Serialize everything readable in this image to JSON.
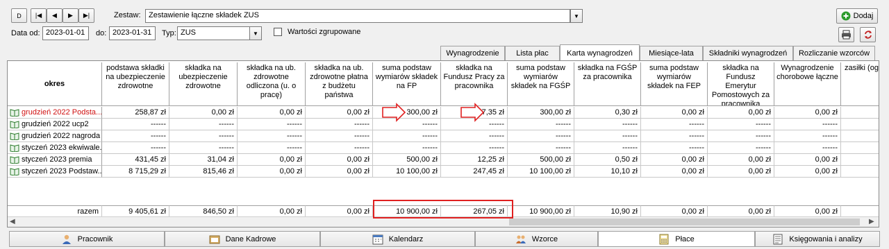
{
  "nav": {
    "first": "D",
    "prev_block": "|◀",
    "prev": "◀",
    "next": "▶",
    "last": "▶|"
  },
  "zestaw": {
    "label": "Zestaw:",
    "value": "Zestawienie łączne składek ZUS"
  },
  "filters": {
    "data_od_label": "Data od:",
    "data_od": "2023-01-01",
    "do_label": "do:",
    "do": "2023-01-31",
    "typ_label": "Typ:",
    "typ": "ZUS",
    "grouped_label": "Wartości zgrupowane"
  },
  "toolbar": {
    "dodaj": "Dodaj"
  },
  "tabs": [
    {
      "label": "Wynagrodzenie"
    },
    {
      "label": "Lista płac"
    },
    {
      "label": "Karta wynagrodzeń"
    },
    {
      "label": "Miesiące-lata"
    },
    {
      "label": "Składniki wynagrodzeń"
    },
    {
      "label": "Rozliczanie wzorców"
    }
  ],
  "table": {
    "row_header": "okres",
    "columns": [
      "podstawa składki na ubezpieczenie zdrowotne",
      "składka na ubezpieczenie zdrowotne",
      "składka na ub. zdrowotne odliczona (u. o pracę)",
      "składka na ub. zdrowotne płatna z budżetu państwa",
      "suma podstaw wymiarów składek na FP",
      "składka na Fundusz Pracy za pracownika",
      "suma podstaw wymiarów składek na FGŚP",
      "składka na FGŚP za pracownika",
      "suma podstaw wymiarów składek na FEP",
      "składka na Fundusz Emerytur Pomostowych za pracownika",
      "Wynagrodzenie chorobowe łączne",
      "zasiłki (og"
    ],
    "rows": [
      {
        "label": "grudzień 2022 Podsta...",
        "highlight": true,
        "values": [
          "258,87 zł",
          "0,00 zł",
          "0,00 zł",
          "0,00 zł",
          "300,00 zł",
          "7,35 zł",
          "300,00 zł",
          "0,30 zł",
          "0,00 zł",
          "0,00 zł",
          "0,00 zł",
          ""
        ]
      },
      {
        "label": "grudzień 2022 ucp2",
        "highlight": false,
        "values": [
          "------",
          "------",
          "------",
          "------",
          "------",
          "------",
          "------",
          "------",
          "------",
          "------",
          "------",
          ""
        ]
      },
      {
        "label": "grudzień 2022 nagroda",
        "highlight": false,
        "values": [
          "------",
          "------",
          "------",
          "------",
          "------",
          "------",
          "------",
          "------",
          "------",
          "------",
          "------",
          ""
        ]
      },
      {
        "label": "styczeń 2023 ekwiwale...",
        "highlight": false,
        "values": [
          "------",
          "------",
          "------",
          "------",
          "------",
          "------",
          "------",
          "------",
          "------",
          "------",
          "------",
          ""
        ]
      },
      {
        "label": "styczeń 2023 premia",
        "highlight": false,
        "values": [
          "431,45 zł",
          "31,04 zł",
          "0,00 zł",
          "0,00 zł",
          "500,00 zł",
          "12,25 zł",
          "500,00 zł",
          "0,50 zł",
          "0,00 zł",
          "0,00 zł",
          "0,00 zł",
          ""
        ]
      },
      {
        "label": "styczeń 2023 Podstaw...",
        "highlight": false,
        "values": [
          "8 715,29 zł",
          "815,46 zł",
          "0,00 zł",
          "0,00 zł",
          "10 100,00 zł",
          "247,45 zł",
          "10 100,00 zł",
          "10,10 zł",
          "0,00 zł",
          "0,00 zł",
          "0,00 zł",
          ""
        ]
      }
    ],
    "total_label": "razem",
    "totals": [
      "9 405,61 zł",
      "846,50 zł",
      "0,00 zł",
      "0,00 zł",
      "10 900,00 zł",
      "267,05 zł",
      "10 900,00 zł",
      "10,90 zł",
      "0,00 zł",
      "0,00 zł",
      "0,00 zł",
      ""
    ]
  },
  "bottom_tabs": [
    {
      "label": "Pracownik",
      "icon": "person-icon"
    },
    {
      "label": "Dane Kadrowe",
      "icon": "folder-icon"
    },
    {
      "label": "Kalendarz",
      "icon": "calendar-icon"
    },
    {
      "label": "Wzorce",
      "icon": "people-icon"
    },
    {
      "label": "Płace",
      "icon": "calculator-icon"
    },
    {
      "label": "Księgowania i analizy",
      "icon": "ledger-icon"
    }
  ],
  "colors": {
    "highlight_text": "#d01010",
    "annotation_red": "#e02020",
    "accent_green": "#2e9b2e"
  }
}
